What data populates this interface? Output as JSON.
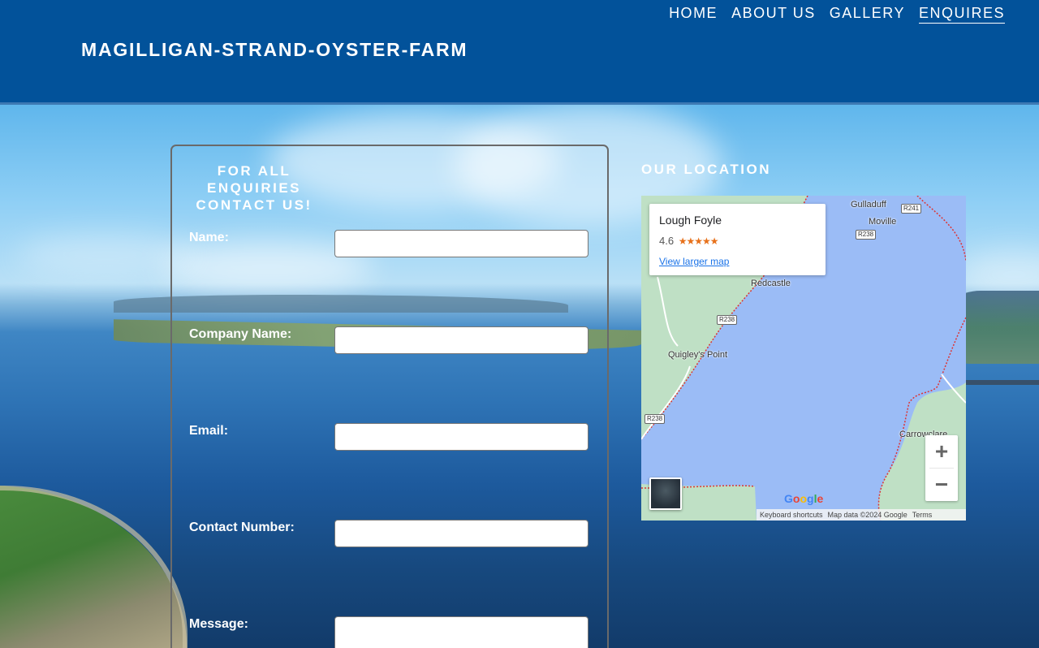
{
  "site": {
    "title": "MAGILLIGAN-STRAND-OYSTER-FARM"
  },
  "nav": {
    "items": [
      "HOME",
      "ABOUT US",
      "GALLERY",
      "ENQUIRES"
    ],
    "active": "ENQUIRES"
  },
  "form": {
    "title": "FOR ALL ENQUIRIES CONTACT US!",
    "fields": [
      {
        "label": "Name:",
        "value": ""
      },
      {
        "label": "Company Name:",
        "value": ""
      },
      {
        "label": "Email:",
        "value": ""
      },
      {
        "label": "Contact Number:",
        "value": ""
      },
      {
        "label": "Message:",
        "value": ""
      }
    ]
  },
  "location": {
    "title": "OUR LOCATION",
    "map": {
      "place_name": "Lough Foyle",
      "rating": "4.6",
      "stars": "★★★★★",
      "larger_map_link": "View larger map",
      "labels": [
        "Gulladuff",
        "Moville",
        "Redcastle",
        "Quigley's Point",
        "Carrowclare"
      ],
      "roads": [
        "R241",
        "R238",
        "R238",
        "R238"
      ],
      "zoom_in": "+",
      "zoom_out": "−",
      "attribution": {
        "shortcuts": "Keyboard shortcuts",
        "data": "Map data ©2024 Google",
        "terms": "Terms"
      },
      "logo": "Google"
    }
  },
  "colors": {
    "header": "#02529a",
    "water": "#9bbcf6",
    "land": "#bfe0c5",
    "link": "#1a73e8",
    "stars": "#e7711b"
  }
}
